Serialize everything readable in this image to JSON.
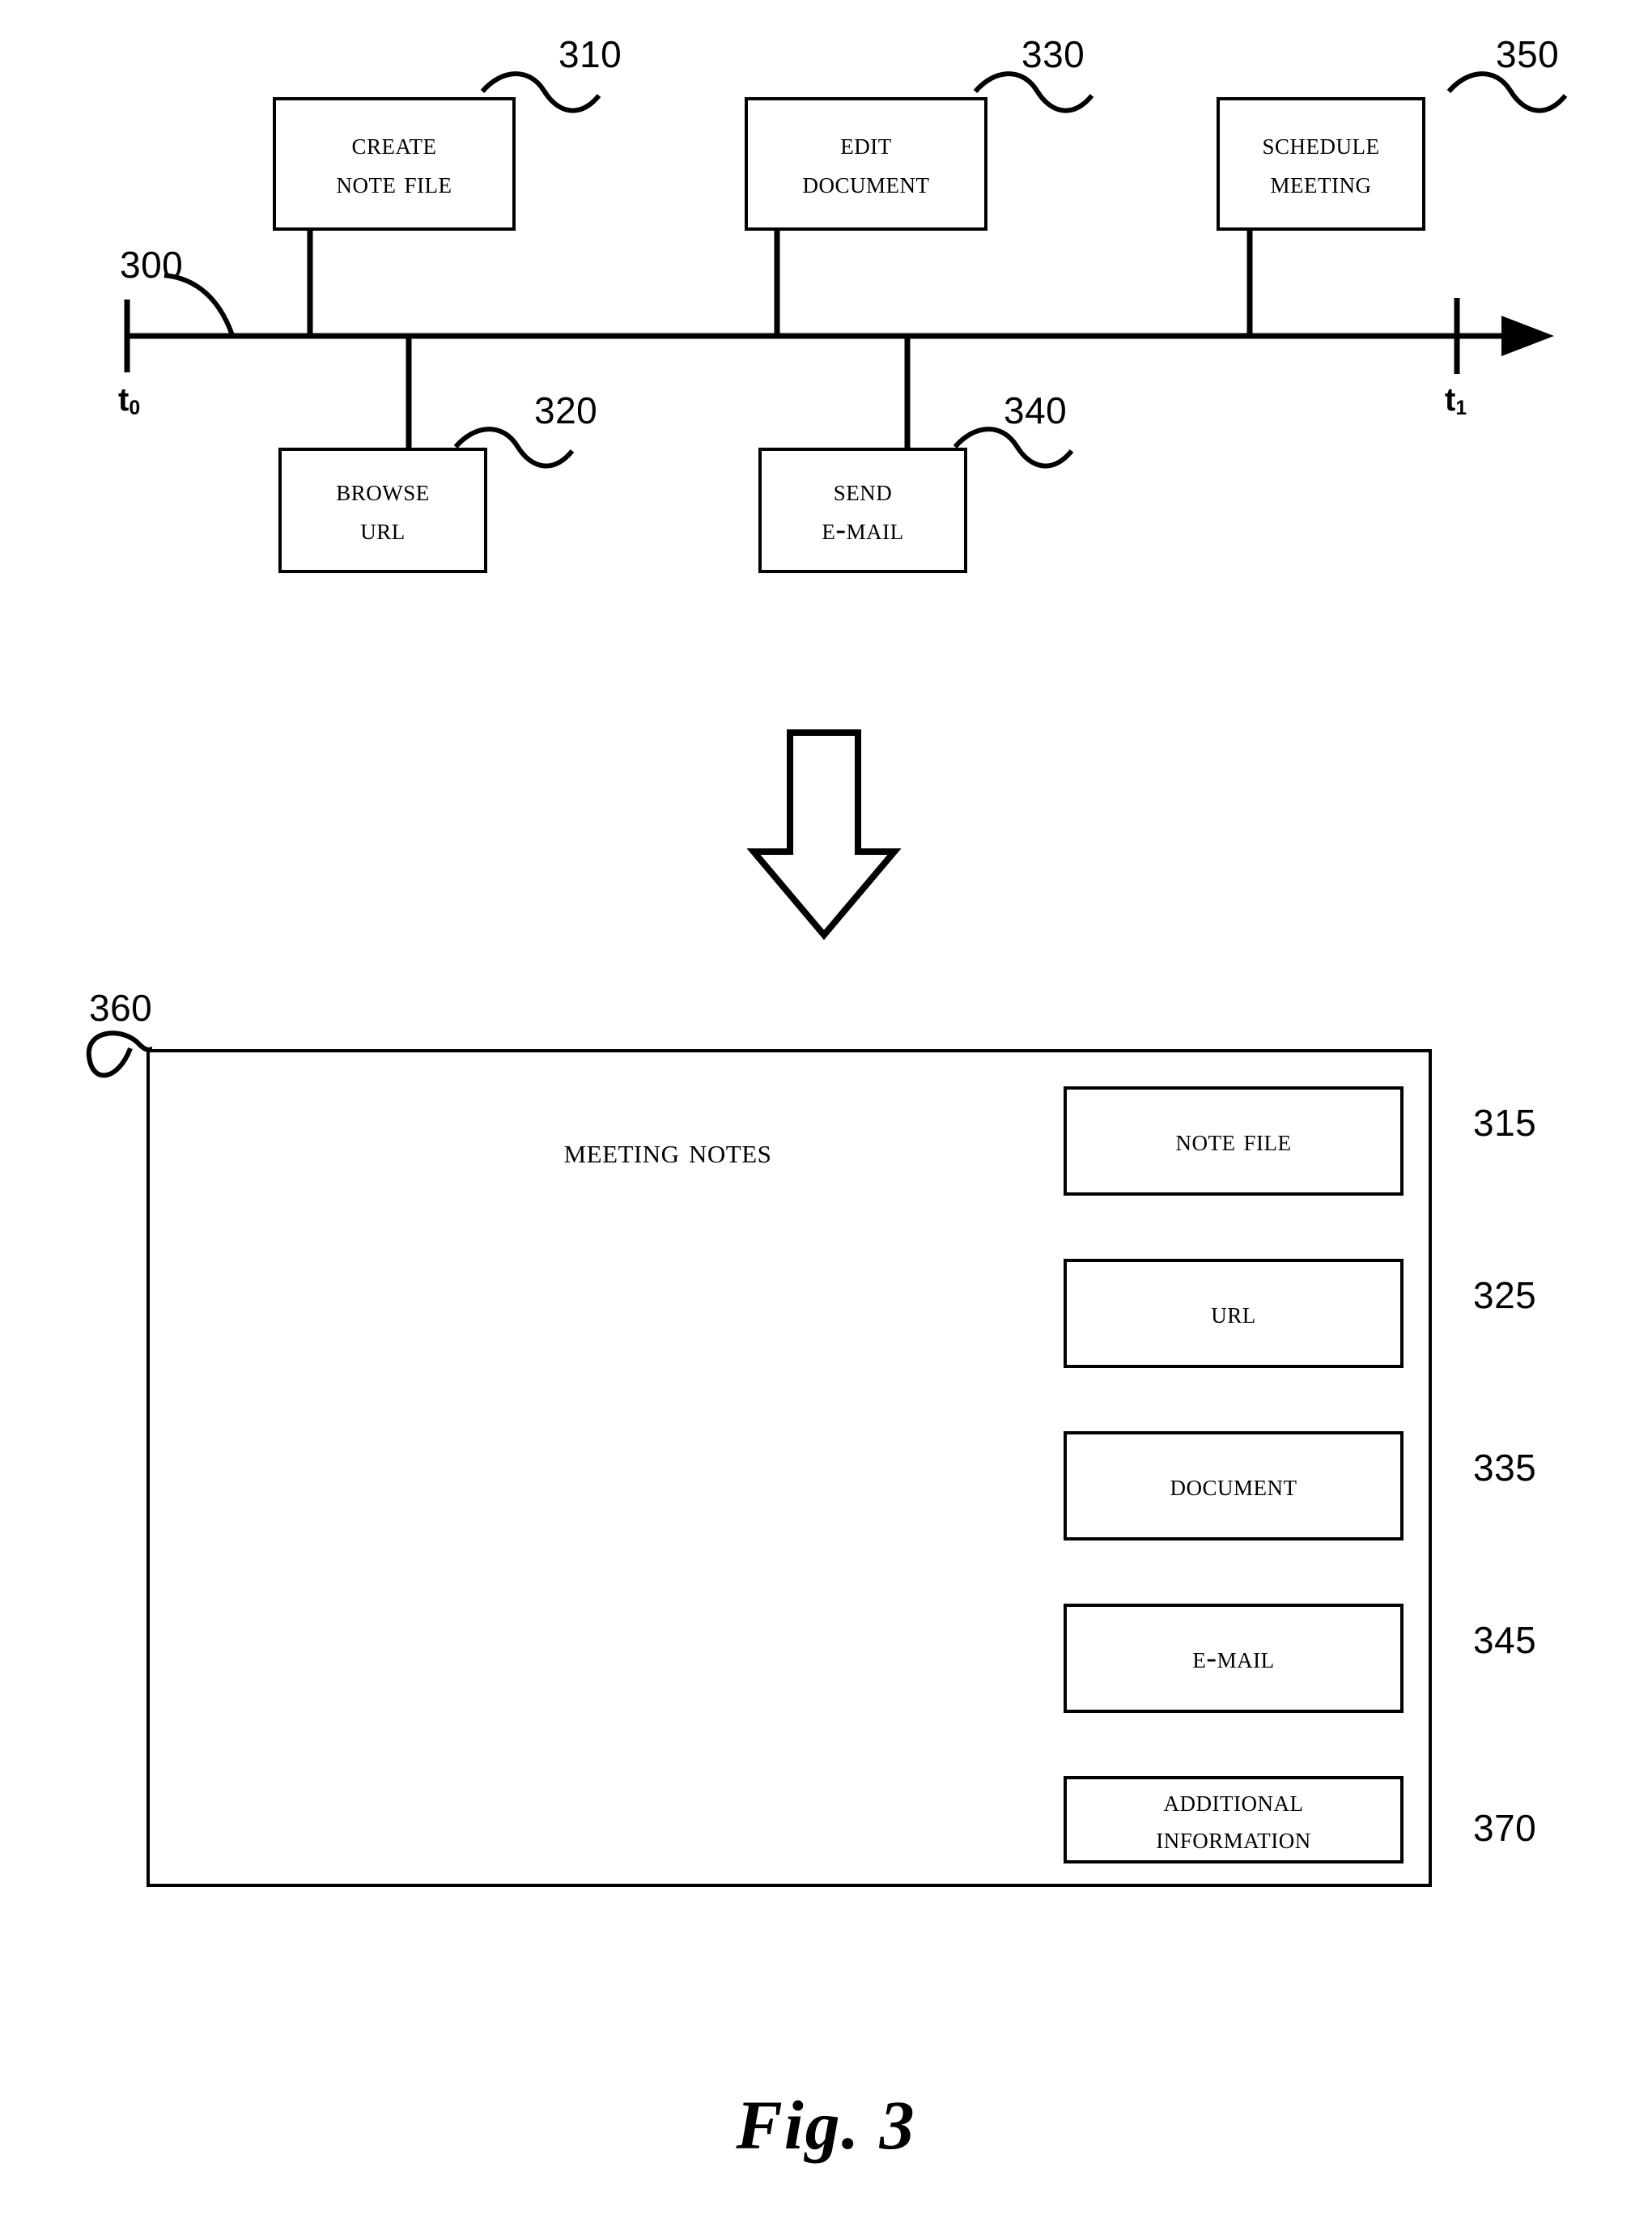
{
  "figure": {
    "caption": "Fig. 3",
    "timeline_ref": "300",
    "panel_ref": "360"
  },
  "timeline": {
    "start_label": "t",
    "start_sub": "0",
    "end_label": "t",
    "end_sub": "1",
    "above_events": [
      {
        "ref": "310",
        "line1": "Create",
        "line2": "Note File"
      },
      {
        "ref": "330",
        "line1": "Edit",
        "line2": "Document"
      },
      {
        "ref": "350",
        "line1": "Schedule",
        "line2": "Meeting"
      }
    ],
    "below_events": [
      {
        "ref": "320",
        "line1": "Browse",
        "line2": "URL"
      },
      {
        "ref": "340",
        "line1": "Send",
        "line2": "E-mail"
      }
    ]
  },
  "transition": {
    "icon": "down-arrow-icon"
  },
  "panel": {
    "ref": "360",
    "title": "Meeting Notes",
    "buttons": [
      {
        "ref": "315",
        "line1": "Note File",
        "line2": ""
      },
      {
        "ref": "325",
        "line1": "URL",
        "line2": ""
      },
      {
        "ref": "335",
        "line1": "Document",
        "line2": ""
      },
      {
        "ref": "345",
        "line1": "E-mail",
        "line2": ""
      },
      {
        "ref": "370",
        "line1": "Additional",
        "line2": "Information"
      }
    ]
  },
  "colors": {
    "ink": "#000000",
    "paper": "#ffffff"
  }
}
